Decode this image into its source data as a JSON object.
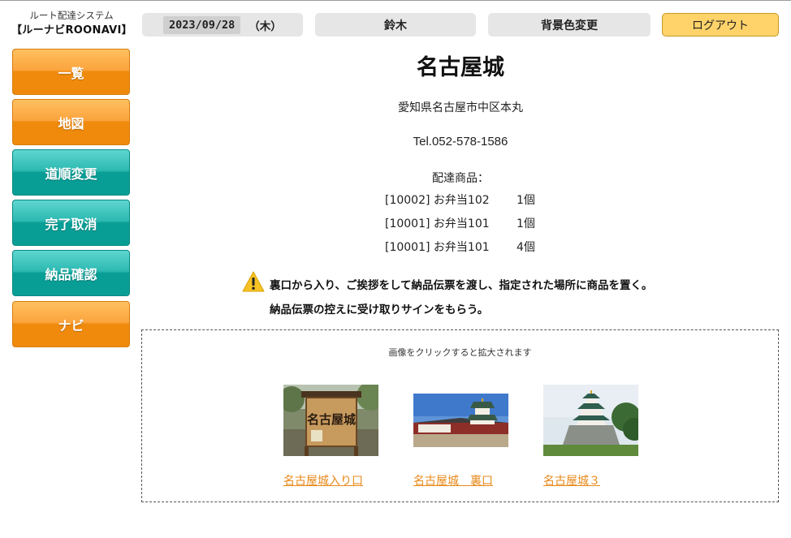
{
  "brand": {
    "subtitle": "ルート配達システム",
    "name": "【ルーナビROONAVI】"
  },
  "header": {
    "date": "2023/09/28",
    "weekday": "（木）",
    "user": "鈴木",
    "bg_change_label": "背景色変更",
    "logout_label": "ログアウト"
  },
  "menu": {
    "items": [
      {
        "label": "一覧",
        "color": "orange"
      },
      {
        "label": "地図",
        "color": "orange"
      },
      {
        "label": "道順変更",
        "color": "teal"
      },
      {
        "label": "完了取消",
        "color": "teal"
      },
      {
        "label": "納品確認",
        "color": "teal"
      },
      {
        "label": "ナビ",
        "color": "orange"
      }
    ]
  },
  "place": {
    "name": "名古屋城",
    "address": "愛知県名古屋市中区本丸",
    "tel": "Tel.052-578-1586",
    "goods_label": "配達商品：",
    "goods": [
      {
        "item": "[10002] お弁当102",
        "qty": "1個"
      },
      {
        "item": "[10001] お弁当101",
        "qty": "1個"
      },
      {
        "item": "[10001] お弁当101",
        "qty": "4個"
      }
    ],
    "note_icon": "warning-icon",
    "note_line1": "裏口から入り、ご挨拶をして納品伝票を渡し、指定された場所に商品を置く。",
    "note_line2": "納品伝票の控えに受け取りサインをもらう。"
  },
  "photos": {
    "hint": "画像をクリックすると拡大されます",
    "items": [
      {
        "caption": "名古屋城入り口",
        "sign_text": "名古屋城"
      },
      {
        "caption": "名古屋城　裏口"
      },
      {
        "caption": "名古屋城３"
      }
    ]
  },
  "colors": {
    "orange": "#ef8a0c",
    "teal": "#089e96",
    "logout": "#ffd36a",
    "link": "#e8891a"
  }
}
